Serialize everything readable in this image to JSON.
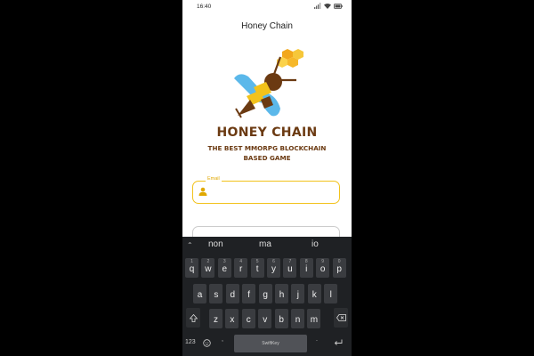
{
  "status_bar": {
    "time": "16:40"
  },
  "app_bar": {
    "title": "Honey Chain"
  },
  "brand": {
    "title": "HONEY CHAIN",
    "subtitle_line1": "THE BEST MMORPG BLOCKCHAIN",
    "subtitle_line2": "BASED GAME"
  },
  "login_form": {
    "email": {
      "label": "Email",
      "value": ""
    }
  },
  "keyboard": {
    "suggestions": [
      "non",
      "ma",
      "io"
    ],
    "row1": [
      {
        "k": "q",
        "n": "1"
      },
      {
        "k": "w",
        "n": "2"
      },
      {
        "k": "e",
        "n": "3"
      },
      {
        "k": "r",
        "n": "4"
      },
      {
        "k": "t",
        "n": "5"
      },
      {
        "k": "y",
        "n": "6"
      },
      {
        "k": "u",
        "n": "7"
      },
      {
        "k": "i",
        "n": "8"
      },
      {
        "k": "o",
        "n": "9"
      },
      {
        "k": "p",
        "n": "0"
      }
    ],
    "row2": [
      "a",
      "s",
      "d",
      "f",
      "g",
      "h",
      "j",
      "k",
      "l"
    ],
    "row3": [
      "z",
      "x",
      "c",
      "v",
      "b",
      "n",
      "m"
    ],
    "numbers_key": "123",
    "comma_key": ",",
    "period_key": ".",
    "space_brand": "SwiftKey",
    "colors": {
      "background": "#1f2124",
      "key": "#3a3c40"
    }
  },
  "theme": {
    "accent": "#f2c21b",
    "brand_brown": "#6b3a12",
    "bee_blue": "#5bb8ea"
  }
}
